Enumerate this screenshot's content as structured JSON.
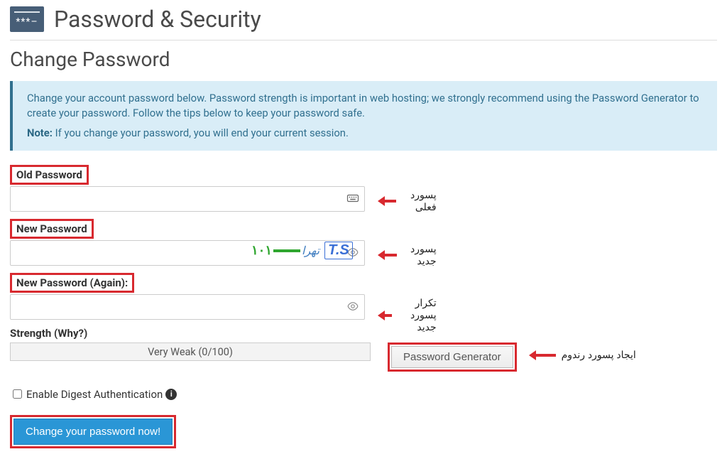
{
  "header": {
    "title": "Password & Security"
  },
  "section": {
    "title": "Change Password"
  },
  "info": {
    "line1": "Change your account password below. Password strength is important in web hosting; we strongly recommend using the Password Generator to create your password. Follow the tips below to keep your password safe.",
    "note_label": "Note:",
    "note_text": "If you change your password, you will end your current session."
  },
  "fields": {
    "old_label": "Old Password",
    "new_label": "New Password",
    "again_label": "New Password (Again):",
    "old_value": "",
    "new_value": "",
    "again_value": ""
  },
  "annotations": {
    "old": "پسورد فعلی",
    "new": "پسورد جدید",
    "again": "تکرار پسورد جدید",
    "generator": "ایجاد پسورد رندوم"
  },
  "watermark": {
    "ts": "T.S",
    "txt": "تهرا",
    "tail": "۱۰۱"
  },
  "strength": {
    "label": "Strength (Why?)",
    "value_text": "Very Weak (0/100)",
    "score": 0,
    "max": 100
  },
  "buttons": {
    "generator": "Password Generator",
    "submit": "Change your password now!"
  },
  "digest": {
    "label": "Enable Digest Authentication",
    "checked": false
  }
}
